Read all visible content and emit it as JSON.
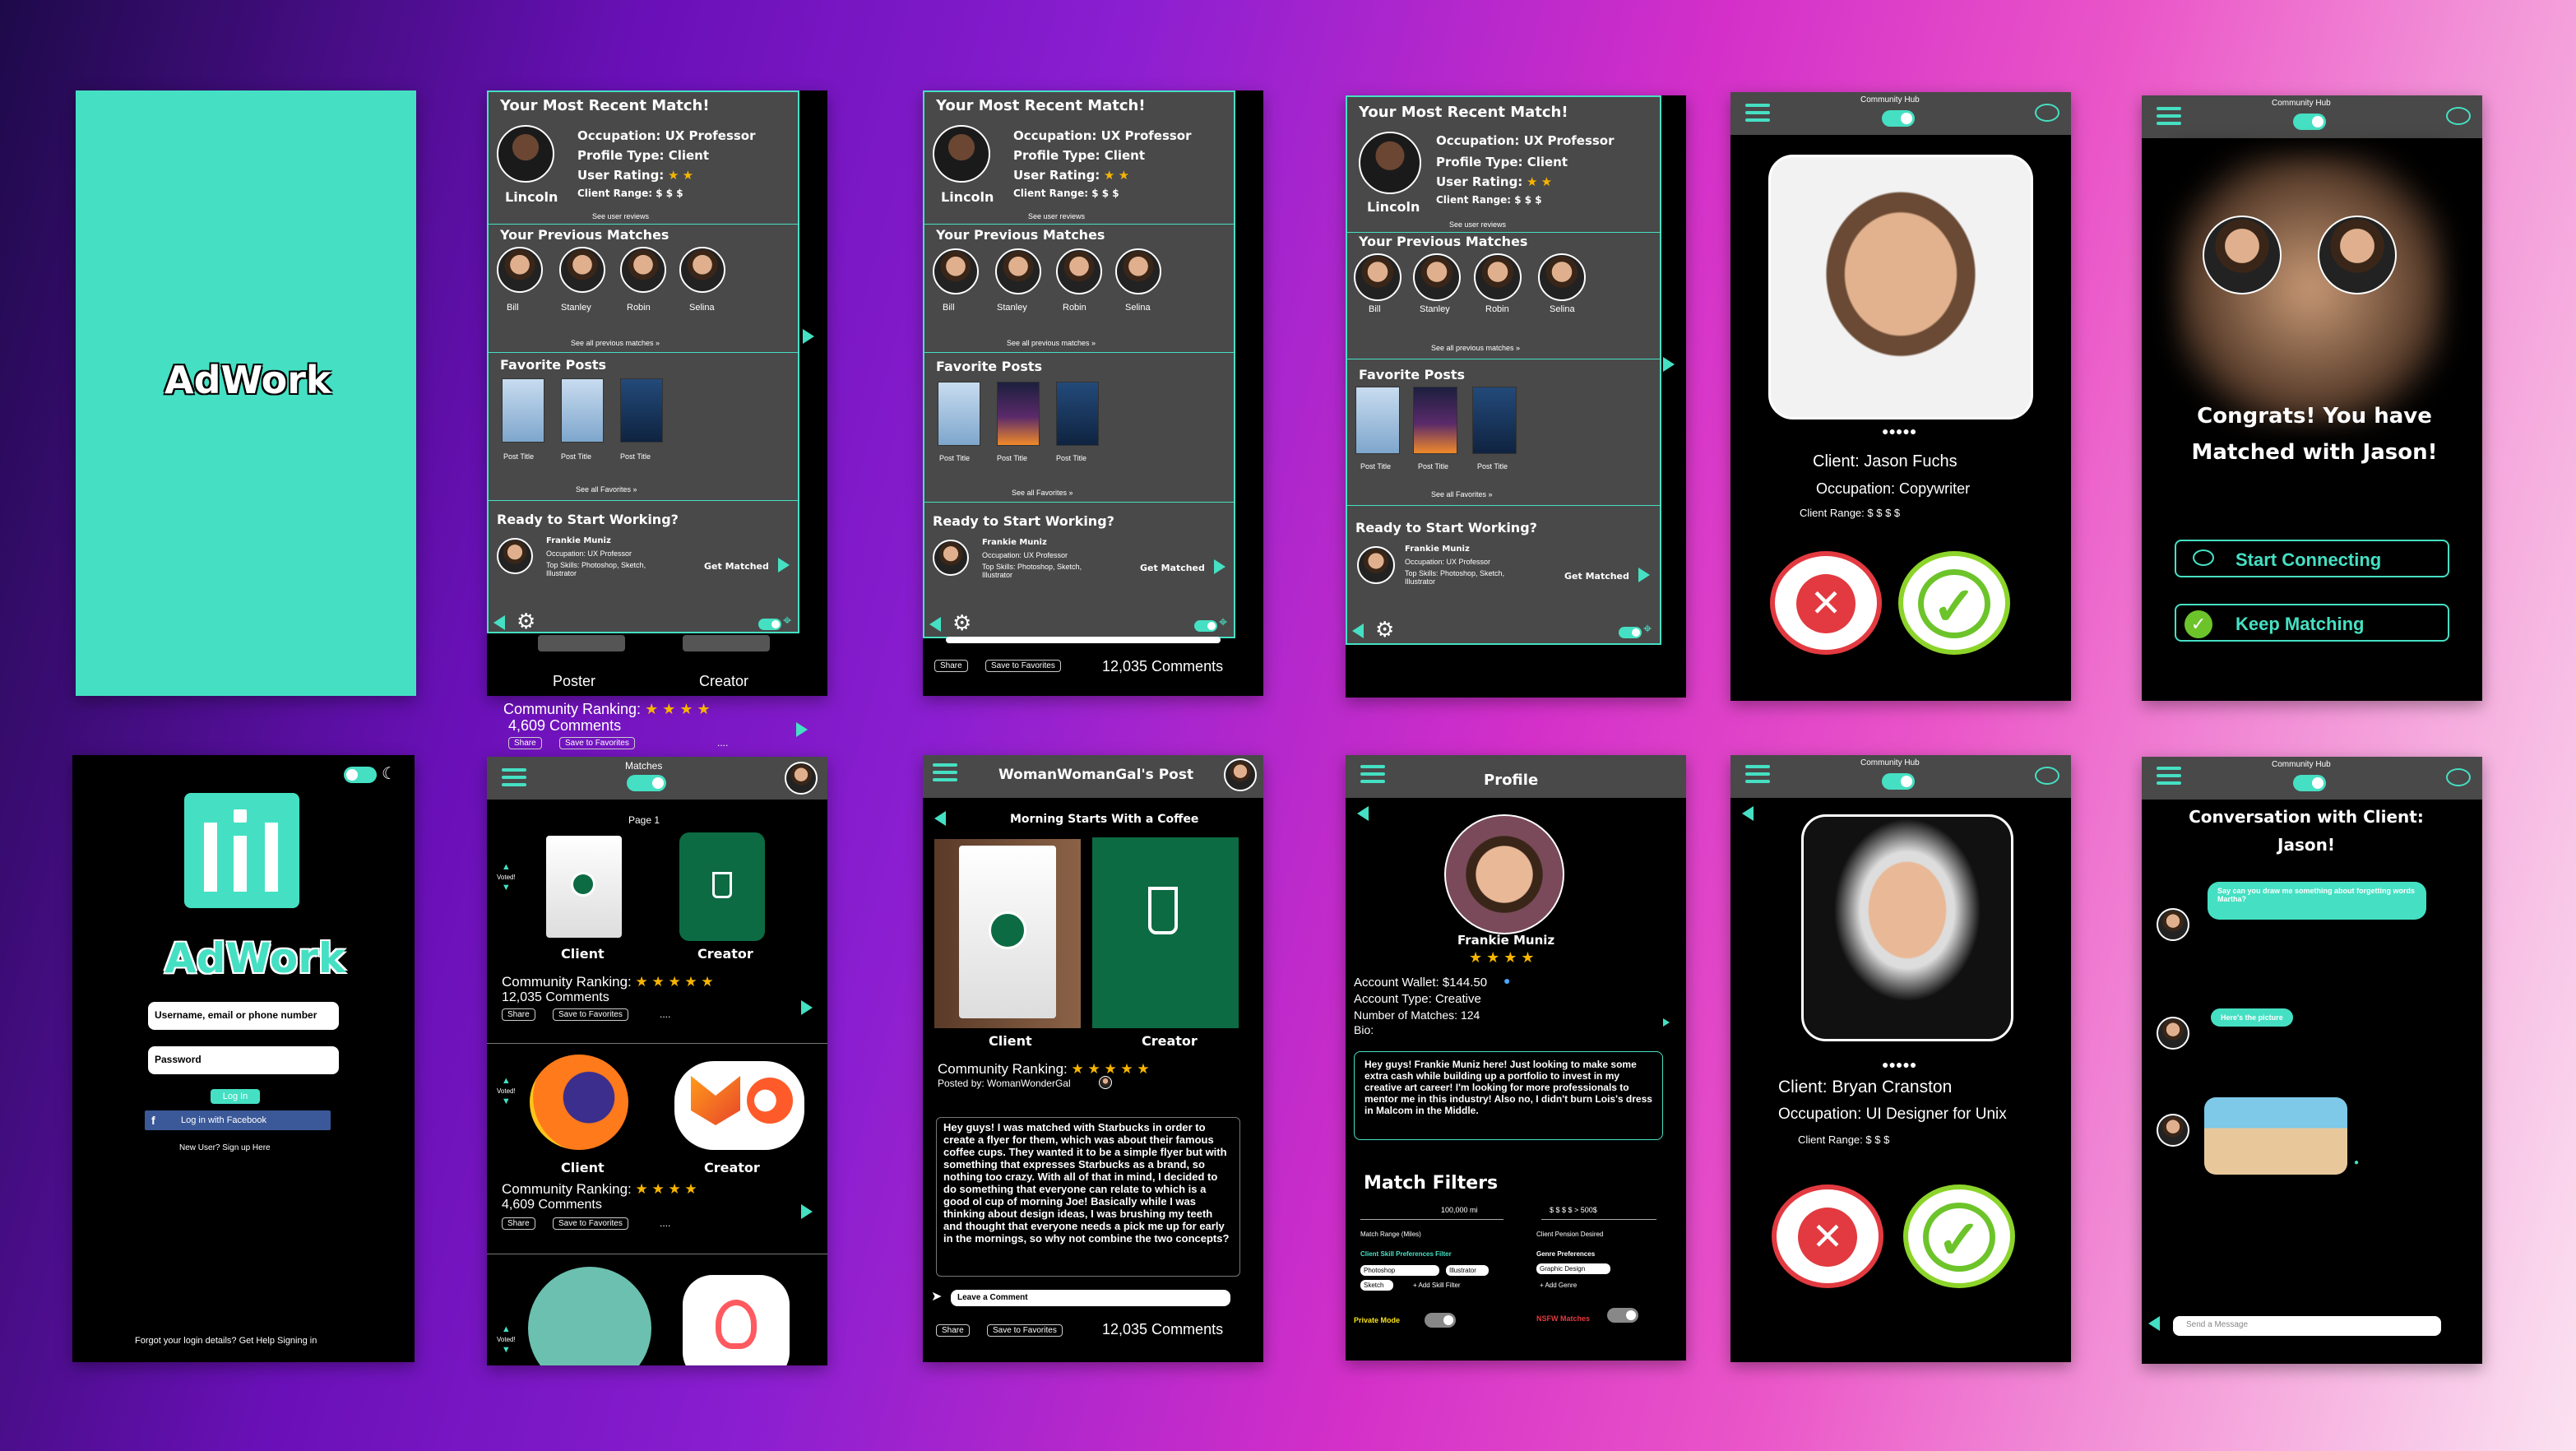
{
  "brand": "AdWork",
  "recent_match": {
    "title": "Your Most Recent Match!",
    "name": "Lincoln",
    "occupation": "Occupation:  UX Professor",
    "profile_type": "Profile Type:  Client",
    "user_rating": "User Rating:",
    "client_range": "Client Range:  $ $ $",
    "see_reviews": "See user reviews",
    "previous_title": "Your Previous Matches",
    "previous": [
      "Bill",
      "Stanley",
      "Robin",
      "Selina"
    ],
    "see_all_matches": "See all previous matches »",
    "favorite_title": "Favorite Posts",
    "post_title": "Post Title",
    "see_all_favorites": "See all Favorites »",
    "ready_title": "Ready to Start Working?",
    "ready_name": "Frankie Muniz",
    "ready_occupation": "Occupation:  UX Professor",
    "ready_skills": "Top Skills:  Photoshop, Sketch, Illustrator",
    "get_matched": "Get Matched"
  },
  "poster_label": "Poster",
  "creator_label": "Creator",
  "share_label": "Share",
  "save_label": "Save to Favorites",
  "ranking_label": "Community Ranking:",
  "comments_4609": "4,609 Comments",
  "comments_12035": "12,035 Comments",
  "ellipsis": "....",
  "community_hub": "Community Hub",
  "jason": {
    "client": "Client: Jason Fuchs",
    "occupation": "Occupation: Copywriter",
    "range": "Client Range:  $  $  $  $"
  },
  "congrats": {
    "title": "Congrats! You have Matched with Jason!",
    "start": "Start Connecting",
    "keep": "Keep Matching"
  },
  "login": {
    "username_placeholder": "Username, email or phone number",
    "password_placeholder": "Password",
    "login_button": "Log In",
    "facebook_button": "Log in with Facebook",
    "signup": "New User? Sign up Here",
    "forgot": "Forgot your login details? Get Help Signing in"
  },
  "matches": {
    "title": "Matches",
    "page": "Page 1",
    "voted": "Voted!",
    "client": "Client",
    "creator": "Creator"
  },
  "womangal": {
    "title": "WomanWomanGal's Post",
    "subtitle": "Morning Starts With a Coffee",
    "client": "Client",
    "creator": "Creator",
    "posted_by": "Posted by: WomanWonderGal",
    "body": "Hey guys! I was matched with Starbucks in order to create a flyer for them, which was about their famous coffee cups. They wanted it to be a simple flyer but with something that expresses Starbucks as a brand, so nothing too crazy.  With all of that in mind, I decided to do something that everyone can relate to which is a good ol cup of morning Joe! Basically while I was thinking about design ideas, I was brushing my teeth and thought that everyone needs a pick me up for early in the mornings, so why not combine the two concepts?",
    "comment_placeholder": "Leave a Comment"
  },
  "profile": {
    "title": "Profile",
    "name": "Frankie Muniz",
    "wallet": "Account Wallet: $144.50",
    "type": "Account Type:  Creative",
    "matches": "Number of Matches: 124",
    "bio_label": "Bio:",
    "bio": "Hey guys! Frankie Muniz here! Just looking to make some extra cash while building up a portfolio to invest in my creative art career! I'm looking for more professionals to mentor me in this industry! Also no, I didn't burn Lois's dress in Malcom in the Middle.",
    "filters_title": "Match Filters",
    "miles": "100,000 mi",
    "pension": "$ $ $ $   > 500$",
    "match_range": "Match Range (Miles)",
    "client_pension": "Client Pension Desired",
    "skill_filter": "Client Skill Preferences Filter",
    "genre_pref": "Genre Preferences",
    "skills": [
      "Photoshop",
      "Illustrator",
      "Sketch"
    ],
    "add_skill": "+ Add Skill Filter",
    "genre": "Graphic Design",
    "add_genre": "+ Add Genre",
    "private": "Private Mode",
    "nsfw": "NSFW Matches"
  },
  "bryan": {
    "client": "Client: Bryan Cranston",
    "occupation": "Occupation: UI Designer for Unix",
    "range": "Client Range:  $  $  $"
  },
  "conversation": {
    "title": "Conversation with Client: Jason!",
    "msg1": "Say can you draw me something about forgetting words Martha?",
    "msg2": "Here's the picture",
    "send_placeholder": "Send a Message"
  },
  "colors": {
    "accent": "#45e0c3",
    "star": "#f7b500",
    "reject": "#e23a40",
    "accept": "#6cc42a"
  }
}
